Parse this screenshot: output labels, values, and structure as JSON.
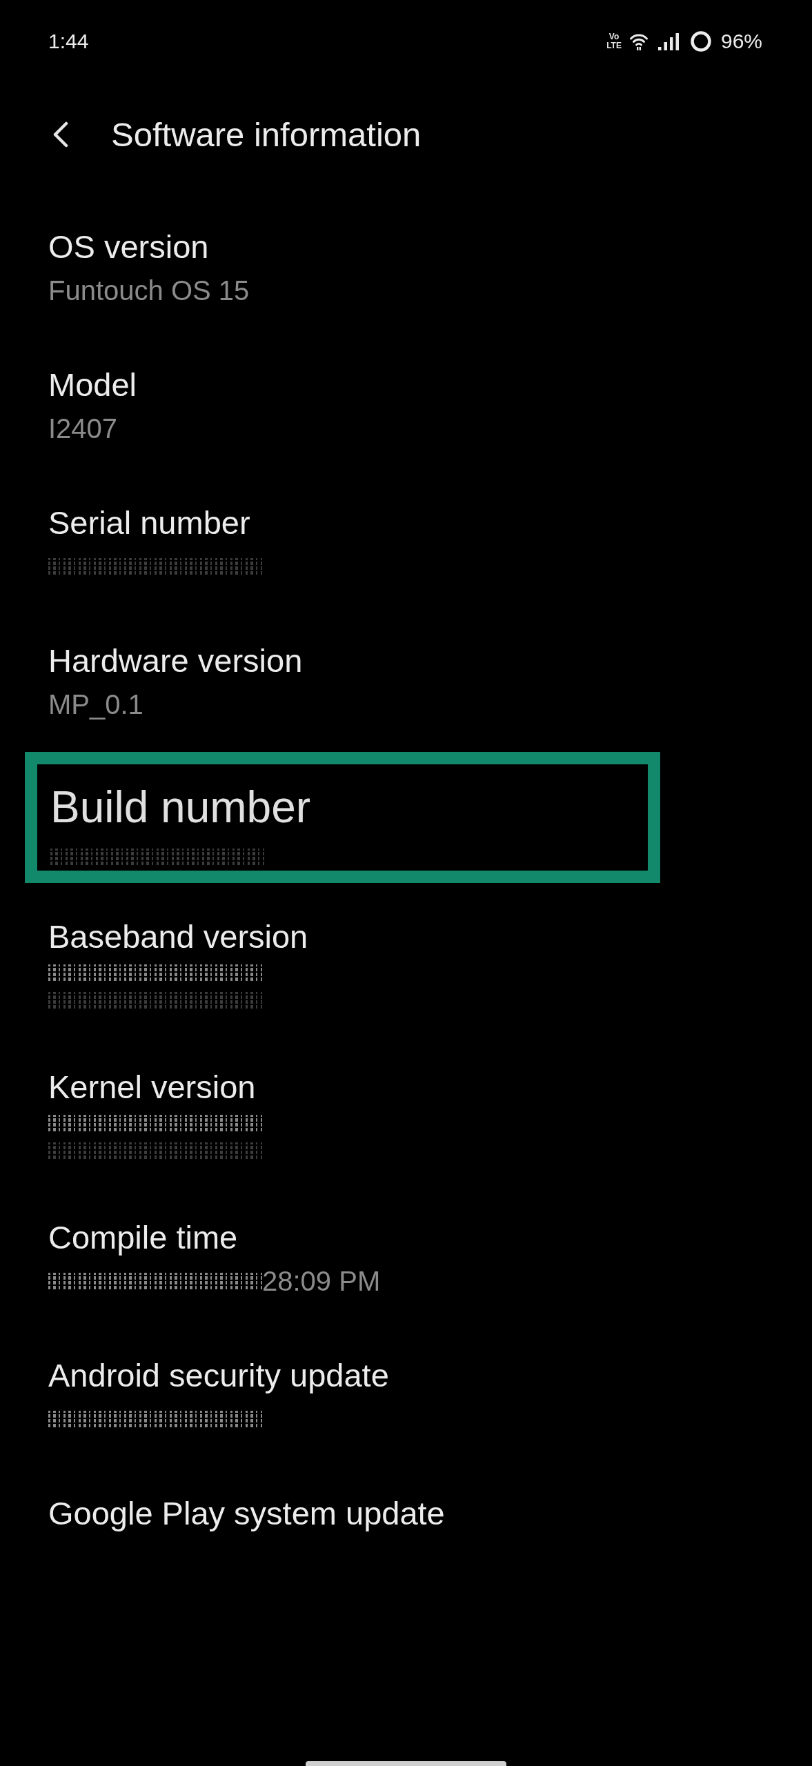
{
  "status_bar": {
    "time": "1:44",
    "network_badge": {
      "top": "Vo",
      "bottom": "LTE"
    },
    "battery": "96%"
  },
  "header": {
    "title": "Software information"
  },
  "items": [
    {
      "label": "OS version",
      "highlighted": false,
      "value": {
        "kind": "text",
        "text": "Funtouch OS 15"
      }
    },
    {
      "label": "Model",
      "highlighted": false,
      "value": {
        "kind": "text",
        "text": "I2407"
      }
    },
    {
      "label": "Serial number",
      "highlighted": false,
      "value": {
        "kind": "redacted",
        "lines": [
          {
            "faint": true
          }
        ]
      }
    },
    {
      "label": "Hardware version",
      "highlighted": false,
      "value": {
        "kind": "text",
        "text": "MP_0.1"
      }
    },
    {
      "label": "Build number",
      "highlighted": true,
      "value": {
        "kind": "redacted",
        "lines": [
          {
            "faint": true
          }
        ]
      }
    },
    {
      "label": "Baseband version",
      "highlighted": false,
      "value": {
        "kind": "redacted",
        "lines": [
          {
            "faint": false
          },
          {
            "faint": true
          }
        ]
      }
    },
    {
      "label": "Kernel version",
      "highlighted": false,
      "value": {
        "kind": "redacted",
        "lines": [
          {
            "faint": false
          },
          {
            "faint": true
          }
        ]
      }
    },
    {
      "label": "Compile time",
      "highlighted": false,
      "value": {
        "kind": "partly_redacted",
        "lines": [
          {
            "faint": false
          }
        ],
        "text": "28:09 PM"
      }
    },
    {
      "label": "Android security update",
      "highlighted": false,
      "value": {
        "kind": "redacted",
        "lines": [
          {
            "faint": false
          }
        ]
      }
    },
    {
      "label": "Google Play system update",
      "highlighted": false
    }
  ]
}
